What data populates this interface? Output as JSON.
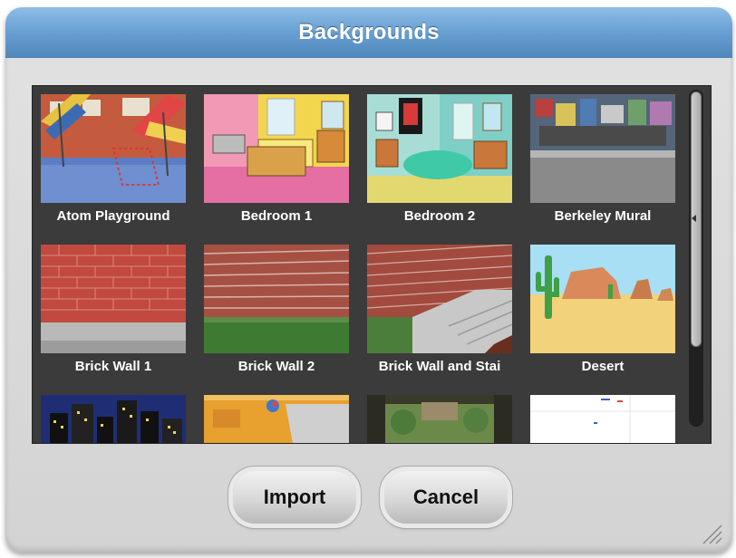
{
  "dialog": {
    "title": "Backgrounds",
    "import_label": "Import",
    "cancel_label": "Cancel",
    "accent": "#5f97cb"
  },
  "items": [
    {
      "label": "Atom Playground"
    },
    {
      "label": "Bedroom 1"
    },
    {
      "label": "Bedroom 2"
    },
    {
      "label": "Berkeley Mural"
    },
    {
      "label": "Brick Wall 1"
    },
    {
      "label": "Brick Wall 2"
    },
    {
      "label": "Brick Wall and Stai"
    },
    {
      "label": "Desert"
    },
    {
      "label": ""
    },
    {
      "label": ""
    },
    {
      "label": ""
    },
    {
      "label": ""
    }
  ],
  "icons": {
    "resize": "resize-grip-icon",
    "scroll": "scroll-arrow-icon"
  }
}
